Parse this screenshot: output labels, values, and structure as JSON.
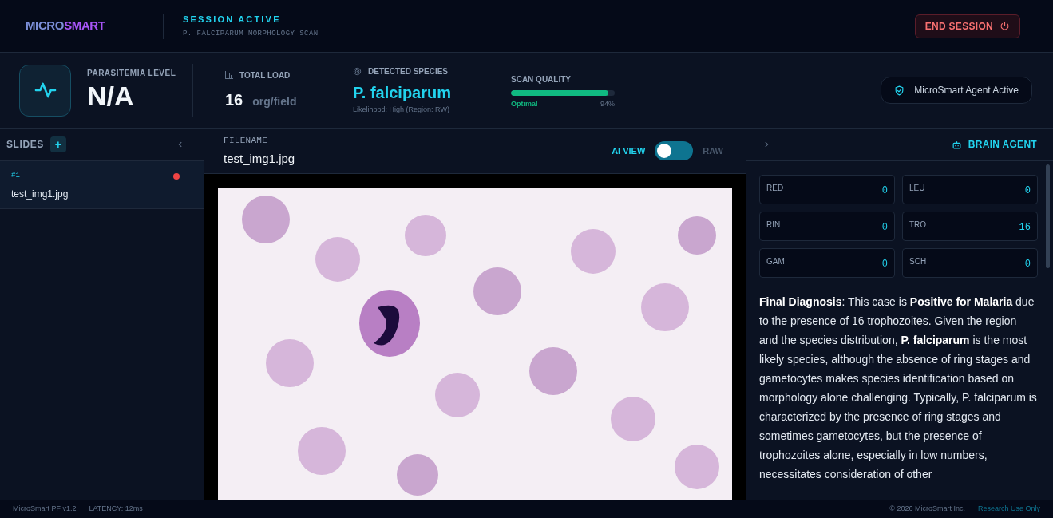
{
  "header": {
    "logo": {
      "part1": "MICRO",
      "part2": "SMART"
    },
    "status": "SESSION ACTIVE",
    "subtitle": "P. FALCIPARUM MORPHOLOGY SCAN",
    "end_button": "END SESSION"
  },
  "stats": {
    "parasitemia": {
      "label": "PARASITEMIA LEVEL",
      "value": "N/A"
    },
    "total_load": {
      "label": "TOTAL LOAD",
      "value": "16",
      "unit": "org/field"
    },
    "species": {
      "label": "DETECTED SPECIES",
      "value": "P. falciparum",
      "note": "Likelihood: High (Region: RW)"
    },
    "scan_quality": {
      "label": "SCAN QUALITY",
      "level": 0.94,
      "status": "Optimal",
      "reading": "94%"
    },
    "agent_badge": "MicroSmart Agent Active"
  },
  "slides": {
    "title": "SLIDES",
    "add": "+",
    "items": [
      {
        "index": "#1",
        "name": "test_img1.jpg",
        "selected": true,
        "color": "#ef4444"
      }
    ]
  },
  "viewer": {
    "filename_label": "FILENAME",
    "filename": "test_img1.jpg",
    "modes": [
      {
        "label": "AI VIEW",
        "selected": true
      },
      {
        "label": "RAW",
        "selected": false
      }
    ]
  },
  "agent": {
    "title": "BRAIN AGENT",
    "counts": [
      {
        "label": "RED",
        "value": "0"
      },
      {
        "label": "LEU",
        "value": "0"
      },
      {
        "label": "RIN",
        "value": "0"
      },
      {
        "label": "TRO",
        "value": "16"
      },
      {
        "label": "GAM",
        "value": "0"
      },
      {
        "label": "SCH",
        "value": "0"
      }
    ],
    "diagnosis": "**Final Diagnosis**: This case is **Positive for Malaria** due to the presence of 16 trophozoites. Given the region and the species distribution, **P. falciparum** is the most likely species, although the absence of ring stages and gametocytes makes species identification based on morphology alone challenging. Typically, P. falciparum is characterized by the presence of ring stages and sometimes gametocytes, but the presence of trophozoites alone, especially in low numbers, necessitates consideration of other"
  },
  "footer": {
    "version": "MicroSmart PF v1.2",
    "latency": "LATENCY: 12ms",
    "copyright": "© 2026 MicroSmart Inc.",
    "link": "Research Use Only"
  }
}
